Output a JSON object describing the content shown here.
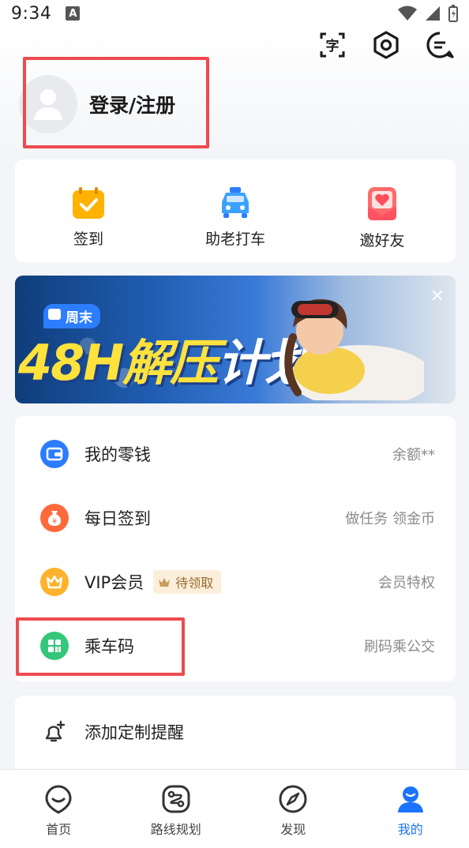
{
  "status_bar": {
    "time": "9:34",
    "a_icon": "A"
  },
  "header": {
    "icons": [
      "translate-icon",
      "settings-icon",
      "message-icon"
    ]
  },
  "profile": {
    "login_label": "登录/注册"
  },
  "quick_actions": [
    {
      "label": "签到",
      "icon": "calendar-check-icon"
    },
    {
      "label": "助老打车",
      "icon": "taxi-icon"
    },
    {
      "label": "邀好友",
      "icon": "invite-heart-icon"
    }
  ],
  "banner": {
    "tag": "周末",
    "title_main": "48H解压",
    "title_plan": "计划",
    "close": "✕"
  },
  "menu": [
    {
      "label": "我的零钱",
      "right": "余额**",
      "icon": "wallet-icon",
      "color": "#2c7cff"
    },
    {
      "label": "每日签到",
      "right": "做任务 领金币",
      "icon": "coin-bag-icon",
      "color": "#ff6a3d"
    },
    {
      "label": "VIP会员",
      "badge": "待领取",
      "right": "会员特权",
      "icon": "vip-crown-icon",
      "color": "#ffb22c"
    },
    {
      "label": "乘车码",
      "right": "刷码乘公交",
      "icon": "qr-code-icon",
      "color": "#34c77b"
    }
  ],
  "remind": {
    "label": "添加定制提醒",
    "icon": "bell-add-icon"
  },
  "tabs": [
    {
      "label": "首页",
      "icon": "home-icon"
    },
    {
      "label": "路线规划",
      "icon": "route-icon"
    },
    {
      "label": "发现",
      "icon": "compass-icon"
    },
    {
      "label": "我的",
      "icon": "profile-icon",
      "active": true
    }
  ],
  "colors": {
    "accent": "#1a72ff",
    "highlight_box": "#ee4a4f"
  }
}
